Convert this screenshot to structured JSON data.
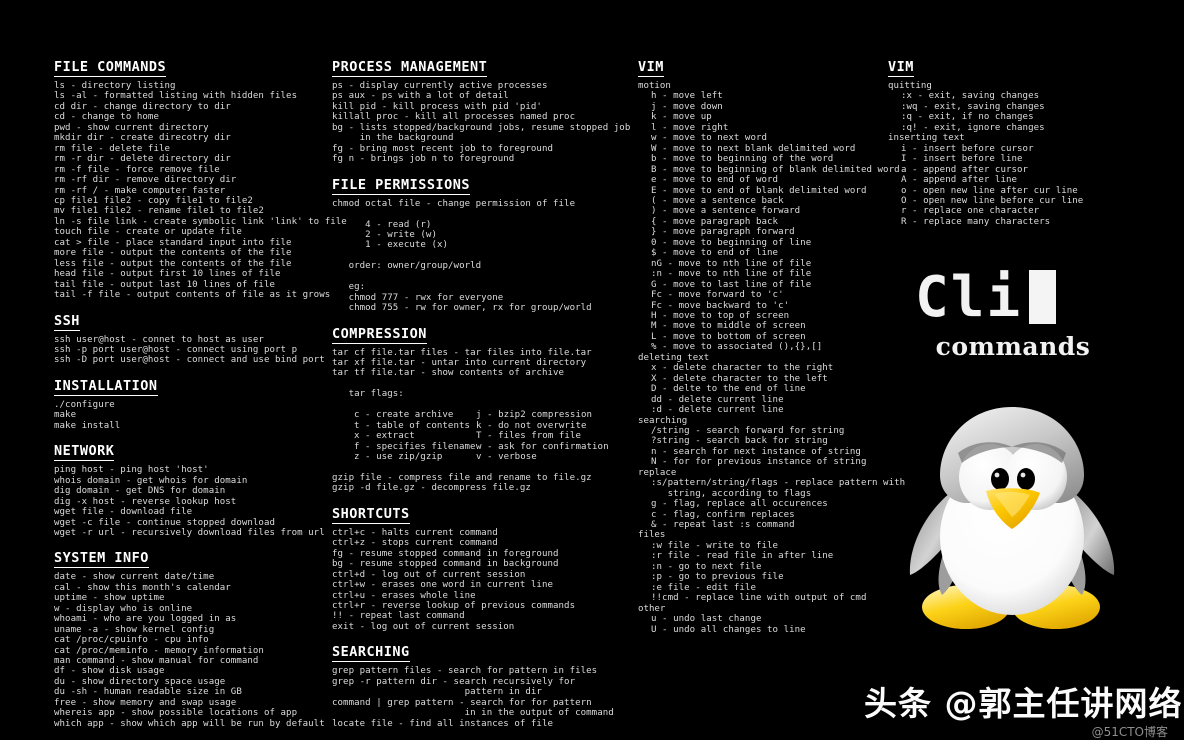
{
  "meta": {
    "background_color": "#000000",
    "text_color": "#dcdcdc",
    "heading_color": "#ffffff"
  },
  "logo": {
    "word": "Cli",
    "sub": "commands",
    "cursor_color": "#f4f4f4"
  },
  "watermark": {
    "main": "头条 @郭主任讲网络",
    "sub": "@51CTO博客"
  },
  "tux": {
    "body_color": "#ffffff",
    "head_color": "#d8d8d8",
    "beak_color": "#f5c400",
    "feet_color": "#f2c200",
    "eye_color": "#000000"
  },
  "columns": [
    {
      "id": "col1",
      "sections": [
        {
          "heading": "FILE COMMANDS",
          "lines": [
            "ls - directory listing",
            "ls -al - formatted listing with hidden files",
            "cd dir - change directory to dir",
            "cd - change to home",
            "pwd - show current directory",
            "mkdir dir - create direcotry dir",
            "rm file - delete file",
            "rm -r dir - delete directory dir",
            "rm -f file - force remove file",
            "rm -rf dir - remove directory dir",
            "rm -rf / - make computer faster",
            "cp file1 file2 - copy file1 to file2",
            "mv file1 file2 - rename file1 to file2",
            "ln -s file link - create symbolic link 'link' to file",
            "touch file - create or update file",
            "cat > file - place standard input into file",
            "more file - output the contents of the file",
            "less file - output the contents of the file",
            "head file - output first 10 lines of file",
            "tail file - output last 10 lines of file",
            "tail -f file - output contents of file as it grows"
          ]
        },
        {
          "heading": "SSH",
          "lines": [
            "ssh user@host - connet to host as user",
            "ssh -p port user@host - connect using port p",
            "ssh -D port user@host - connect and use bind port"
          ]
        },
        {
          "heading": "INSTALLATION",
          "lines": [
            "./configure",
            "make",
            "make install"
          ]
        },
        {
          "heading": "NETWORK",
          "lines": [
            "ping host - ping host 'host'",
            "whois domain - get whois for domain",
            "dig domain - get DNS for domain",
            "dig -x host - reverse lookup host",
            "wget file - download file",
            "wget -c file - continue stopped download",
            "wget -r url - recursively download files from url"
          ]
        },
        {
          "heading": "SYSTEM INFO",
          "lines": [
            "date - show current date/time",
            "cal - show this month's calendar",
            "uptime - show uptime",
            "w - display who is online",
            "whoami - who are you logged in as",
            "uname -a - show kernel config",
            "cat /proc/cpuinfo - cpu info",
            "cat /proc/meminfo - memory information",
            "man command - show manual for command",
            "df - show disk usage",
            "du - show directory space usage",
            "du -sh - human readable size in GB",
            "free - show memory and swap usage",
            "whereis app - show possible locations of app",
            "which app - show which app will be run by default"
          ]
        }
      ]
    },
    {
      "id": "col2",
      "sections": [
        {
          "heading": "PROCESS MANAGEMENT",
          "lines": [
            "ps - display currently active processes",
            "ps aux - ps with a lot of detail",
            "kill pid - kill process with pid 'pid'",
            "killall proc - kill all processes named proc",
            "bg - lists stopped/background jobs, resume stopped job",
            "     in the background",
            "fg - bring most recent job to foreground",
            "fg n - brings job n to foreground"
          ]
        },
        {
          "heading": "FILE PERMISSIONS",
          "lines": [
            "chmod octal file - change permission of file",
            "",
            "      4 - read (r)",
            "      2 - write (w)",
            "      1 - execute (x)",
            "",
            "   order: owner/group/world",
            "",
            "   eg:",
            "   chmod 777 - rwx for everyone",
            "   chmod 755 - rw for owner, rx for group/world"
          ]
        },
        {
          "heading": "COMPRESSION",
          "lines": [
            "tar cf file.tar files - tar files into file.tar",
            "tar xf file.tar - untar into current directory",
            "tar tf file.tar - show contents of archive",
            "",
            "   tar flags:",
            ""
          ],
          "flag_table": {
            "left": [
              "c - create archive",
              "t - table of contents",
              "x - extract",
              "f - specifies filename",
              "z - use zip/gzip"
            ],
            "right": [
              "j - bzip2 compression",
              "k - do not overwrite",
              "T - files from file",
              "w - ask for confirmation",
              "v - verbose"
            ]
          },
          "after_lines": [
            "",
            "gzip file - compress file and rename to file.gz",
            "gzip -d file.gz - decompress file.gz"
          ]
        },
        {
          "heading": "SHORTCUTS",
          "lines": [
            "ctrl+c - halts current command",
            "ctrl+z - stops current command",
            "fg - resume stopped command in foreground",
            "bg - resume stopped command in background",
            "ctrl+d - log out of current session",
            "ctrl+w - erases one word in current line",
            "ctrl+u - erases whole line",
            "ctrl+r - reverse lookup of previous commands",
            "!! - repeat last command",
            "exit - log out of current session"
          ]
        },
        {
          "heading": "SEARCHING",
          "lines": [
            "grep pattern files - search for pattern in files",
            "grep -r pattern dir - search recursively for",
            "                        pattern in dir",
            "command | grep pattern - search for for pattern",
            "                        in in the output of command",
            "locate file - find all instances of file"
          ]
        }
      ]
    },
    {
      "id": "col3",
      "sections": [
        {
          "heading": "VIM",
          "groups": [
            {
              "label": "motion",
              "items": [
                "h - move left",
                "j - move down",
                "k - move up",
                "l - move right",
                "w - move to next word",
                "W - move to next blank delimited word",
                "b - move to beginning of the word",
                "B - move to beginning of blank delimited word",
                "e - move to end of word",
                "E - move to end of blank delimited word",
                "( - move a sentence back",
                ") - move a sentence forward",
                "{ - move paragraph back",
                "} - move paragraph forward",
                "0 - move to beginning of line",
                "$ - move to end of line",
                "nG - move to nth line of file",
                ":n - move to nth line of file",
                "G - move to last line of file",
                "Fc - move forward to 'c'",
                "Fc - move backward to 'c'",
                "H - move to top of screen",
                "M - move to middle of screen",
                "L - move to bottom of screen",
                "% - move to associated (),{},[]"
              ]
            },
            {
              "label": "deleting text",
              "items": [
                "x - delete character to the right",
                "X - delete character to the left",
                "D - delte to the end of line",
                "dd - delete current line",
                ":d - delete current line"
              ]
            },
            {
              "label": "searching",
              "items": [
                "/string - search forward for string",
                "?string - search back for string",
                "n - search for next instance of string",
                "N - for for previous instance of string"
              ]
            },
            {
              "label": "replace",
              "items": [
                ":s/pattern/string/flags - replace pattern with",
                "   string, according to flags",
                "g - flag, replace all occurences",
                "c - flag, confirm replaces",
                "& - repeat last :s command"
              ]
            },
            {
              "label": "files",
              "items": [
                ":w file - write to file",
                ":r file - read file in after line",
                ":n - go to next file",
                ":p - go to previous file",
                ":e file - edit file",
                "!!cmd - replace line with output of cmd"
              ]
            },
            {
              "label": "other",
              "items": [
                "u - undo last change",
                "U - undo all changes to line"
              ]
            }
          ]
        }
      ]
    },
    {
      "id": "col4",
      "sections": [
        {
          "heading": "VIM",
          "groups": [
            {
              "label": "quitting",
              "items": [
                ":x - exit, saving changes",
                ":wq - exit, saving changes",
                ":q - exit, if no changes",
                ":q! - exit, ignore changes"
              ]
            },
            {
              "label": "inserting text",
              "items": [
                "i - insert before cursor",
                "I - insert before line",
                "a - append after cursor",
                "A - append after line",
                "o - open new line after cur line",
                "O - open new line before cur line",
                "r - replace one character",
                "R - replace many characters"
              ]
            }
          ]
        }
      ]
    }
  ]
}
